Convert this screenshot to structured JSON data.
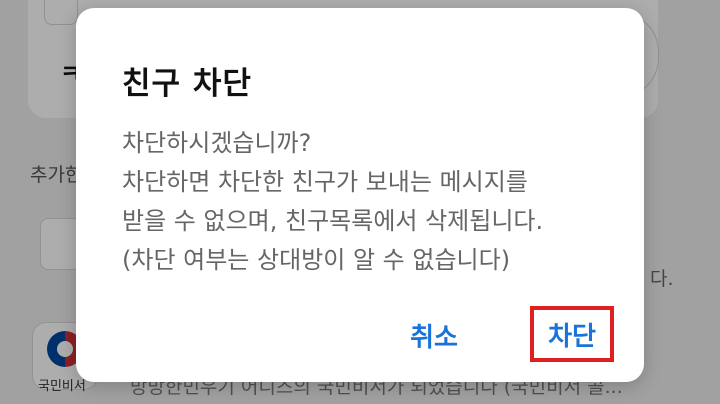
{
  "background": {
    "card_letter": "ㅋ",
    "section_label": "추가한",
    "row_tail": "다.",
    "gov_label": "국민비서",
    "bottom_text": "방방한민우기 어디즈의 국민비서가 되었습니다 (국민비서 콜..."
  },
  "dialog": {
    "title": "친구 차단",
    "message_lines": [
      "차단하시겠습니까?",
      "차단하면 차단한 친구가 보내는 메시지를",
      "받을 수 없으며, 친구목록에서 삭제됩니다.",
      "(차단 여부는 상대방이 알 수 없습니다)"
    ],
    "cancel_label": "취소",
    "confirm_label": "차단"
  },
  "colors": {
    "accent": "#1a73d9",
    "highlight_border": "#e02020"
  }
}
